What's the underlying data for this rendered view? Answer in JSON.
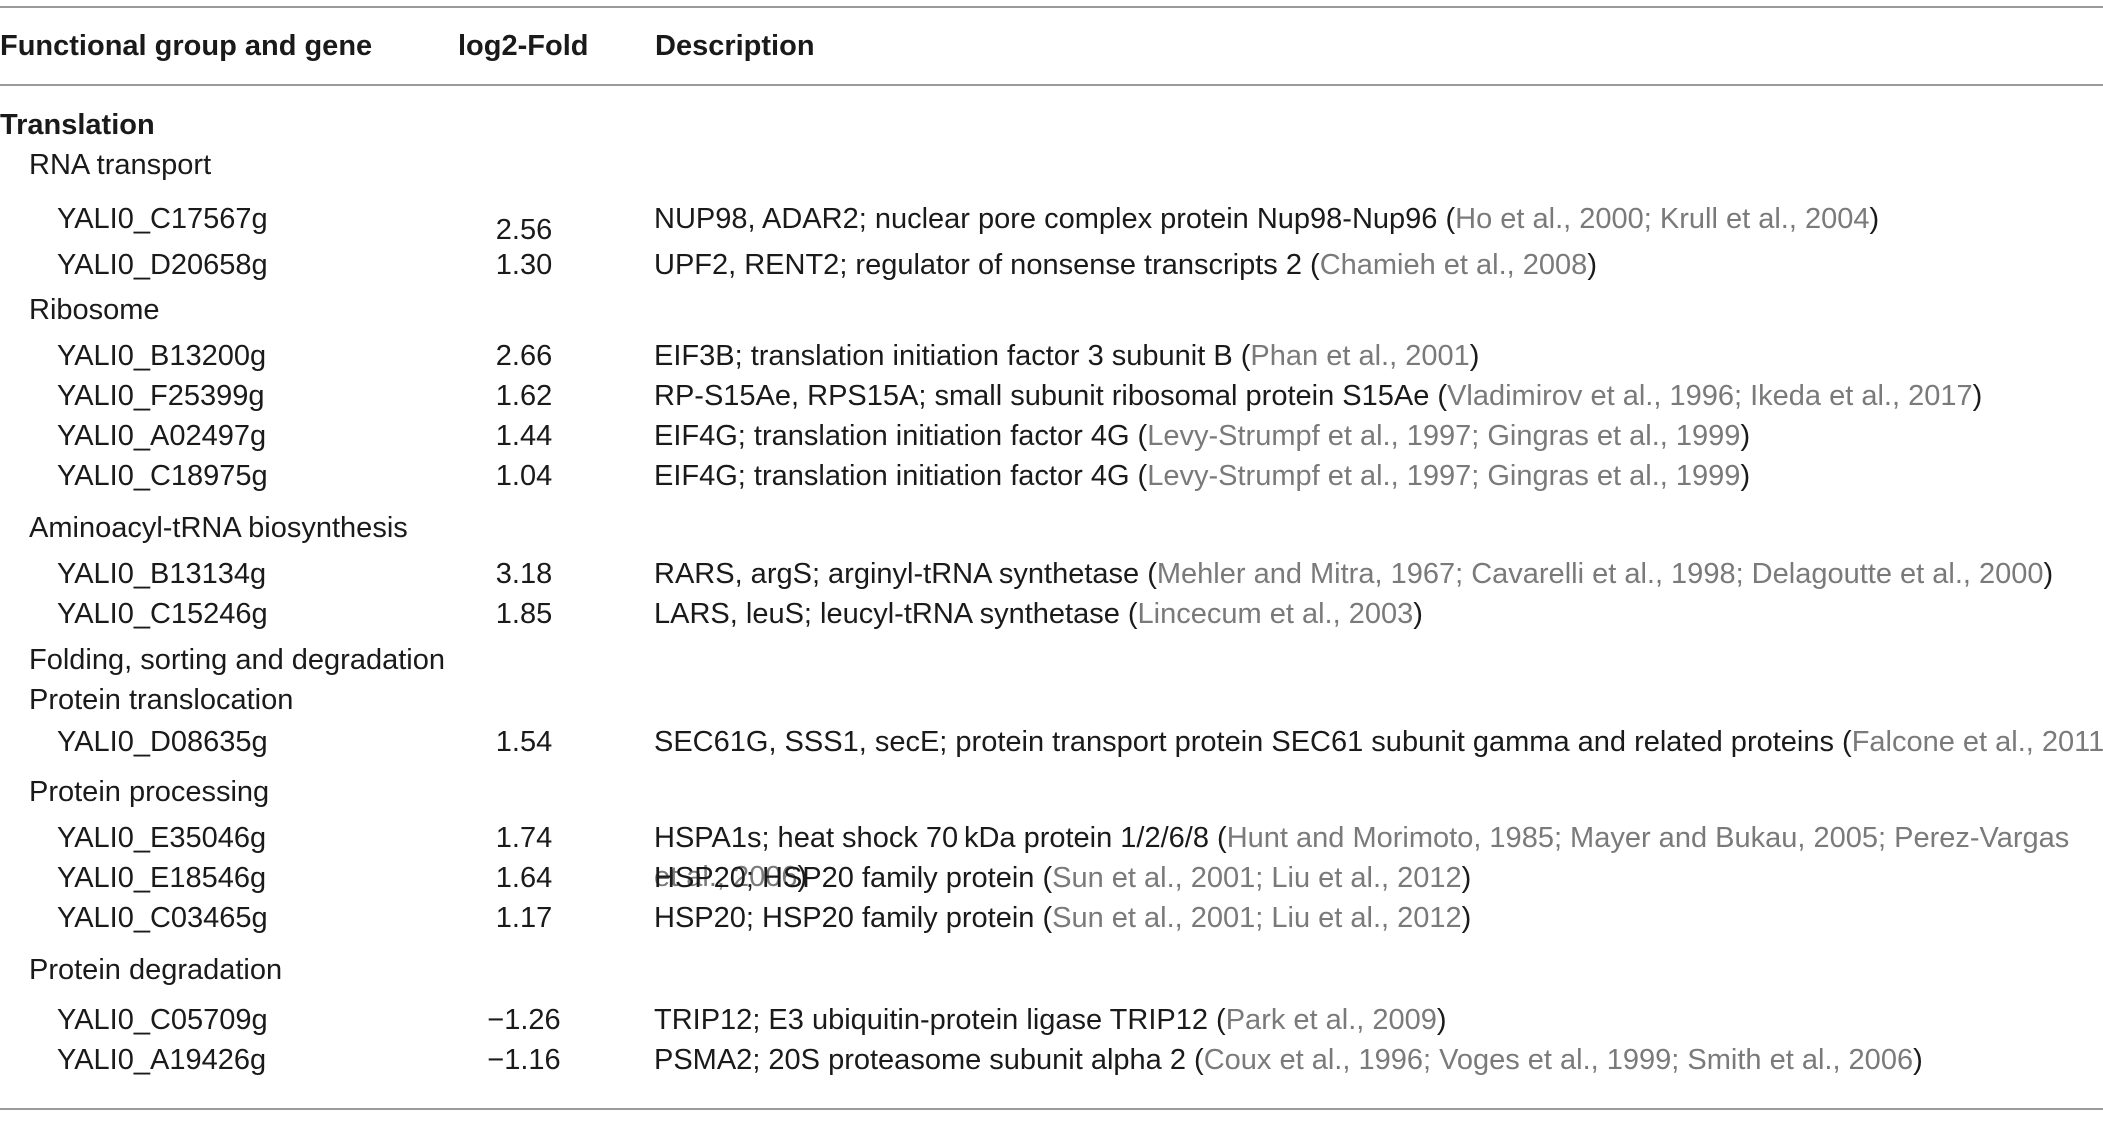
{
  "columns": {
    "gene": "Functional group and gene",
    "fold": "log2-Fold",
    "desc": "Description"
  },
  "rows": [
    {
      "type": "group",
      "label": "Translation"
    },
    {
      "type": "sub",
      "label": "RNA transport"
    },
    {
      "type": "gene",
      "gene": "YALI0_C17567g",
      "fold": "2.56",
      "desc": "NUP98, ADAR2; nuclear pore complex protein Nup98-Nup96",
      "cite": "Ho et al., 2000; Krull et al., 2004"
    },
    {
      "type": "gene",
      "gene": "YALI0_D20658g",
      "fold": "1.30",
      "desc": "UPF2, RENT2; regulator of nonsense transcripts 2",
      "cite": "Chamieh et al., 2008"
    },
    {
      "type": "sub",
      "label": "Ribosome"
    },
    {
      "type": "gene",
      "gene": "YALI0_B13200g",
      "fold": "2.66",
      "desc": "EIF3B; translation initiation factor 3 subunit B",
      "cite": "Phan et al., 2001"
    },
    {
      "type": "gene",
      "gene": "YALI0_F25399g",
      "fold": "1.62",
      "desc": "RP-S15Ae, RPS15A; small subunit ribosomal protein S15Ae",
      "cite": "Vladimirov et al., 1996; Ikeda et al., 2017"
    },
    {
      "type": "gene",
      "gene": "YALI0_A02497g",
      "fold": "1.44",
      "desc": "EIF4G; translation initiation factor 4G",
      "cite": "Levy-Strumpf et al., 1997; Gingras et al., 1999"
    },
    {
      "type": "gene",
      "gene": "YALI0_C18975g",
      "fold": "1.04",
      "desc": "EIF4G; translation initiation factor 4G",
      "cite": "Levy-Strumpf et al., 1997; Gingras et al., 1999"
    },
    {
      "type": "sub",
      "label": "Aminoacyl-tRNA biosynthesis"
    },
    {
      "type": "gene",
      "gene": "YALI0_B13134g",
      "fold": "3.18",
      "desc": "RARS, argS; arginyl-tRNA synthetase",
      "cite": "Mehler and Mitra, 1967; Cavarelli et al., 1998; Delagoutte et al., 2000"
    },
    {
      "type": "gene",
      "gene": "YALI0_C15246g",
      "fold": "1.85",
      "desc": "LARS, leuS; leucyl-tRNA synthetase",
      "cite": "Lincecum et al., 2003"
    },
    {
      "type": "sub",
      "label": "Folding, sorting and degradation"
    },
    {
      "type": "sub",
      "label": "Protein translocation"
    },
    {
      "type": "gene",
      "gene": "YALI0_D08635g",
      "fold": "1.54",
      "desc": "SEC61G, SSS1, secE; protein transport protein SEC61 subunit gamma and related proteins",
      "cite": "Falcone et al., 2011"
    },
    {
      "type": "sub",
      "label": "Protein processing"
    },
    {
      "type": "gene",
      "gene": "YALI0_E35046g",
      "fold": "1.74",
      "desc": "HSPA1s; heat shock 70 kDa protein 1/2/6/8",
      "cite": "Hunt and Morimoto, 1985; Mayer and Bukau, 2005; Perez-Vargas",
      "cite2": "et al., 2006"
    },
    {
      "type": "gene",
      "gene": "YALI0_E18546g",
      "fold": "1.64",
      "desc": "HSP20; HSP20 family protein",
      "cite": "Sun et al., 2001; Liu et al., 2012"
    },
    {
      "type": "gene",
      "gene": "YALI0_C03465g",
      "fold": "1.17",
      "desc": "HSP20; HSP20 family protein",
      "cite": "Sun et al., 2001; Liu et al., 2012"
    },
    {
      "type": "sub",
      "label": "Protein degradation"
    },
    {
      "type": "gene",
      "gene": "YALI0_C05709g",
      "fold": "−1.26",
      "desc": "TRIP12; E3 ubiquitin-protein ligase TRIP12",
      "cite": "Park et al., 2009"
    },
    {
      "type": "gene",
      "gene": "YALI0_A19426g",
      "fold": "−1.16",
      "desc": "PSMA2; 20S proteasome subunit alpha 2",
      "cite": "Coux et al., 1996; Voges et al., 1999; Smith et al., 2006"
    }
  ]
}
